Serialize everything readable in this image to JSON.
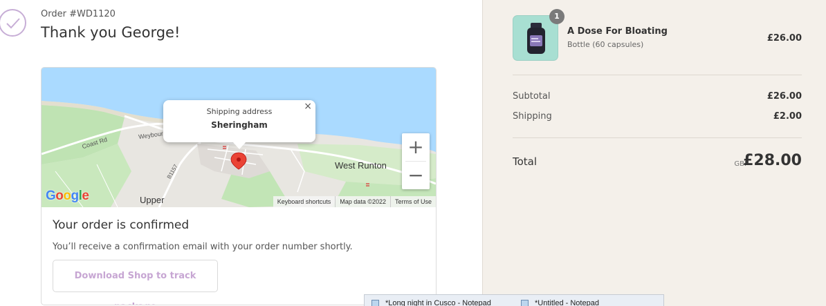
{
  "order": {
    "number": "Order #WD1120",
    "thanks": "Thank you George!"
  },
  "map": {
    "popup_label": "Shipping address",
    "popup_city": "Sheringham",
    "place_west_runton": "West Runton",
    "place_upper": "Upper",
    "road_coast": "Coast Rd",
    "road_weybourne": "Weybourne",
    "road_b1157": "B1157",
    "google_letters": [
      {
        "ch": "G",
        "color": "#4285f4"
      },
      {
        "ch": "o",
        "color": "#ea4335"
      },
      {
        "ch": "o",
        "color": "#fbbc05"
      },
      {
        "ch": "g",
        "color": "#4285f4"
      },
      {
        "ch": "l",
        "color": "#34a853"
      },
      {
        "ch": "e",
        "color": "#ea4335"
      }
    ],
    "attribution": {
      "shortcuts": "Keyboard shortcuts",
      "data": "Map data ©2022",
      "terms": "Terms of Use"
    },
    "zoom_in": "+",
    "zoom_out": "−",
    "close": "×"
  },
  "confirmation": {
    "title": "Your order is confirmed",
    "text": "You’ll receive a confirmation email with your order number shortly.",
    "button": "Download Shop to track package"
  },
  "summary": {
    "item": {
      "quantity": "1",
      "name": "A Dose For Bloating",
      "variant": "Bottle (60 capsules)",
      "price": "£26.00"
    },
    "subtotal_label": "Subtotal",
    "subtotal_value": "£26.00",
    "shipping_label": "Shipping",
    "shipping_value": "£2.00",
    "total_label": "Total",
    "currency": "GBP",
    "total_value": "£28.00"
  },
  "taskbar": {
    "items": [
      "*Long night in Cusco - Notepad",
      "*Untitled - Notepad"
    ]
  },
  "colors": {
    "accent": "#c7a6d3",
    "summary_bg": "#f4f0ea",
    "water": "#aadaff",
    "pin": "#ea4335"
  }
}
